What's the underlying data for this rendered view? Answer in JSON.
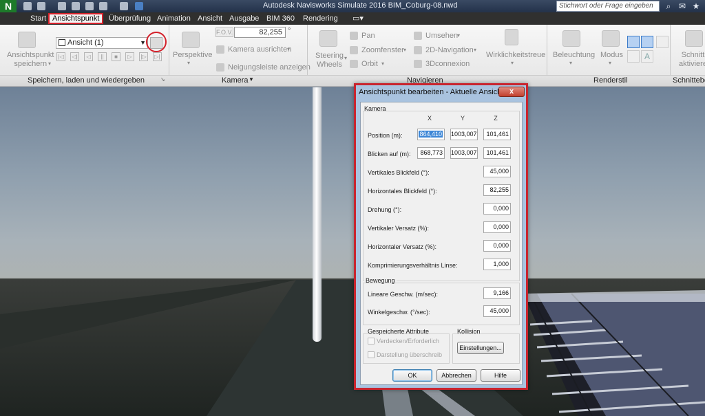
{
  "titlebar": {
    "app_logo": "N",
    "title": "Autodesk Navisworks Simulate 2016    BIM_Coburg-08.nwd",
    "search_placeholder": "Stichwort oder Frage eingeben"
  },
  "tabs": [
    "Start",
    "Ansichtspunkt",
    "Überprüfung",
    "Animation",
    "Ansicht",
    "Ausgabe",
    "BIM 360",
    "Rendering"
  ],
  "active_tab": "Ansichtspunkt",
  "ribbon": {
    "save_viewpoint": "Ansichtspunkt\nspeichern",
    "viewpoint_select": "Ansicht (1)",
    "perspective": "Perspektive",
    "fov_label": "F.O.V.",
    "fov_value": "82,255",
    "fov_unit": "°",
    "align_camera": "Kamera ausrichten",
    "tilt_bar": "Neigungsleiste anzeigen",
    "steering_wheels": "Steering\nWheels",
    "pan": "Pan",
    "zoom_window": "Zoomfenster",
    "orbit": "Orbit",
    "look_around": "Umsehen",
    "nav_2d": "2D-Navigation",
    "connexion": "3Dconnexion",
    "realism": "Wirklichkeitstreue",
    "lighting": "Beleuchtung",
    "mode": "Modus",
    "sectioning": "Schnitt\naktiviere",
    "groups": {
      "save_load": "Speichern, laden und wiedergeben",
      "camera": "Kamera",
      "navigate": "Navigieren",
      "render_style": "Renderstil",
      "sectioning": "Schnittebe"
    }
  },
  "dialog": {
    "title": "Ansichtspunkt bearbeiten - Aktuelle Ansicht",
    "close": "x",
    "camera_section": "Kamera",
    "col_x": "X",
    "col_y": "Y",
    "col_z": "Z",
    "position_label": "Position (m):",
    "position": [
      "864,410",
      "1003,007",
      "101,461"
    ],
    "look_at_label": "Blicken auf (m):",
    "look_at": [
      "868,773",
      "1003,007",
      "101,461"
    ],
    "vfov_label": "Vertikales Blickfeld (°):",
    "vfov": "45,000",
    "hfov_label": "Horizontales Blickfeld (°):",
    "hfov": "82,255",
    "roll_label": "Drehung (°):",
    "roll": "0,000",
    "vshift_label": "Vertikaler Versatz (%):",
    "vshift": "0,000",
    "hshift_label": "Horizontaler Versatz (%):",
    "hshift": "0,000",
    "lens_label": "Komprimierungsverhältnis Linse:",
    "lens": "1,000",
    "motion_section": "Bewegung",
    "linear_speed_label": "Lineare Geschw. (m/sec):",
    "linear_speed": "9,166",
    "angular_speed_label": "Winkelgeschw. (°/sec):",
    "angular_speed": "45,000",
    "saved_attributes_section": "Gespeicherte Attribute",
    "hide_required": "Verdecken/Erforderlich",
    "override_appearance": "Darstellung überschreib",
    "collision_section": "Kollision",
    "settings_button": "Einstellungen...",
    "ok_button": "OK",
    "cancel_button": "Abbrechen",
    "help_button": "Hilfe"
  }
}
